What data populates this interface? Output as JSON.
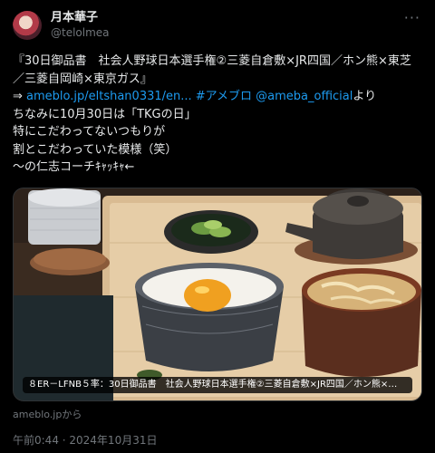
{
  "author": {
    "display_name": "月本華子",
    "handle": "@telolmea"
  },
  "tweet": {
    "line1": "『30日御品書　社会人野球日本選手権②三菱自倉敷×JR四国／ホン熊×東芝／三菱自岡崎×東京ガス』",
    "arrow": "⇒ ",
    "link_url": "ameblo.jp/eltshan0331/en...",
    "hashtag": " #アメブロ",
    "mention": " @ameba_official",
    "yori": "より",
    "line2": "ちなみに10月30日は「TKGの日」",
    "line3": "特にこだわってないつもりが",
    "line4": "割とこだわっていた模様（笑）",
    "line5": "～の仁志コーチｷｬｯｷｬ←"
  },
  "media": {
    "caption": "８ER－LFNB５率：30日御品書　社会人野球日本選手権②三菱自倉敷×JR四国／ホン熊×…"
  },
  "source": "ameblo.jpから",
  "timestamp": "午前0:44 · 2024年10月31日",
  "icons": {
    "more": "more-options-icon"
  }
}
